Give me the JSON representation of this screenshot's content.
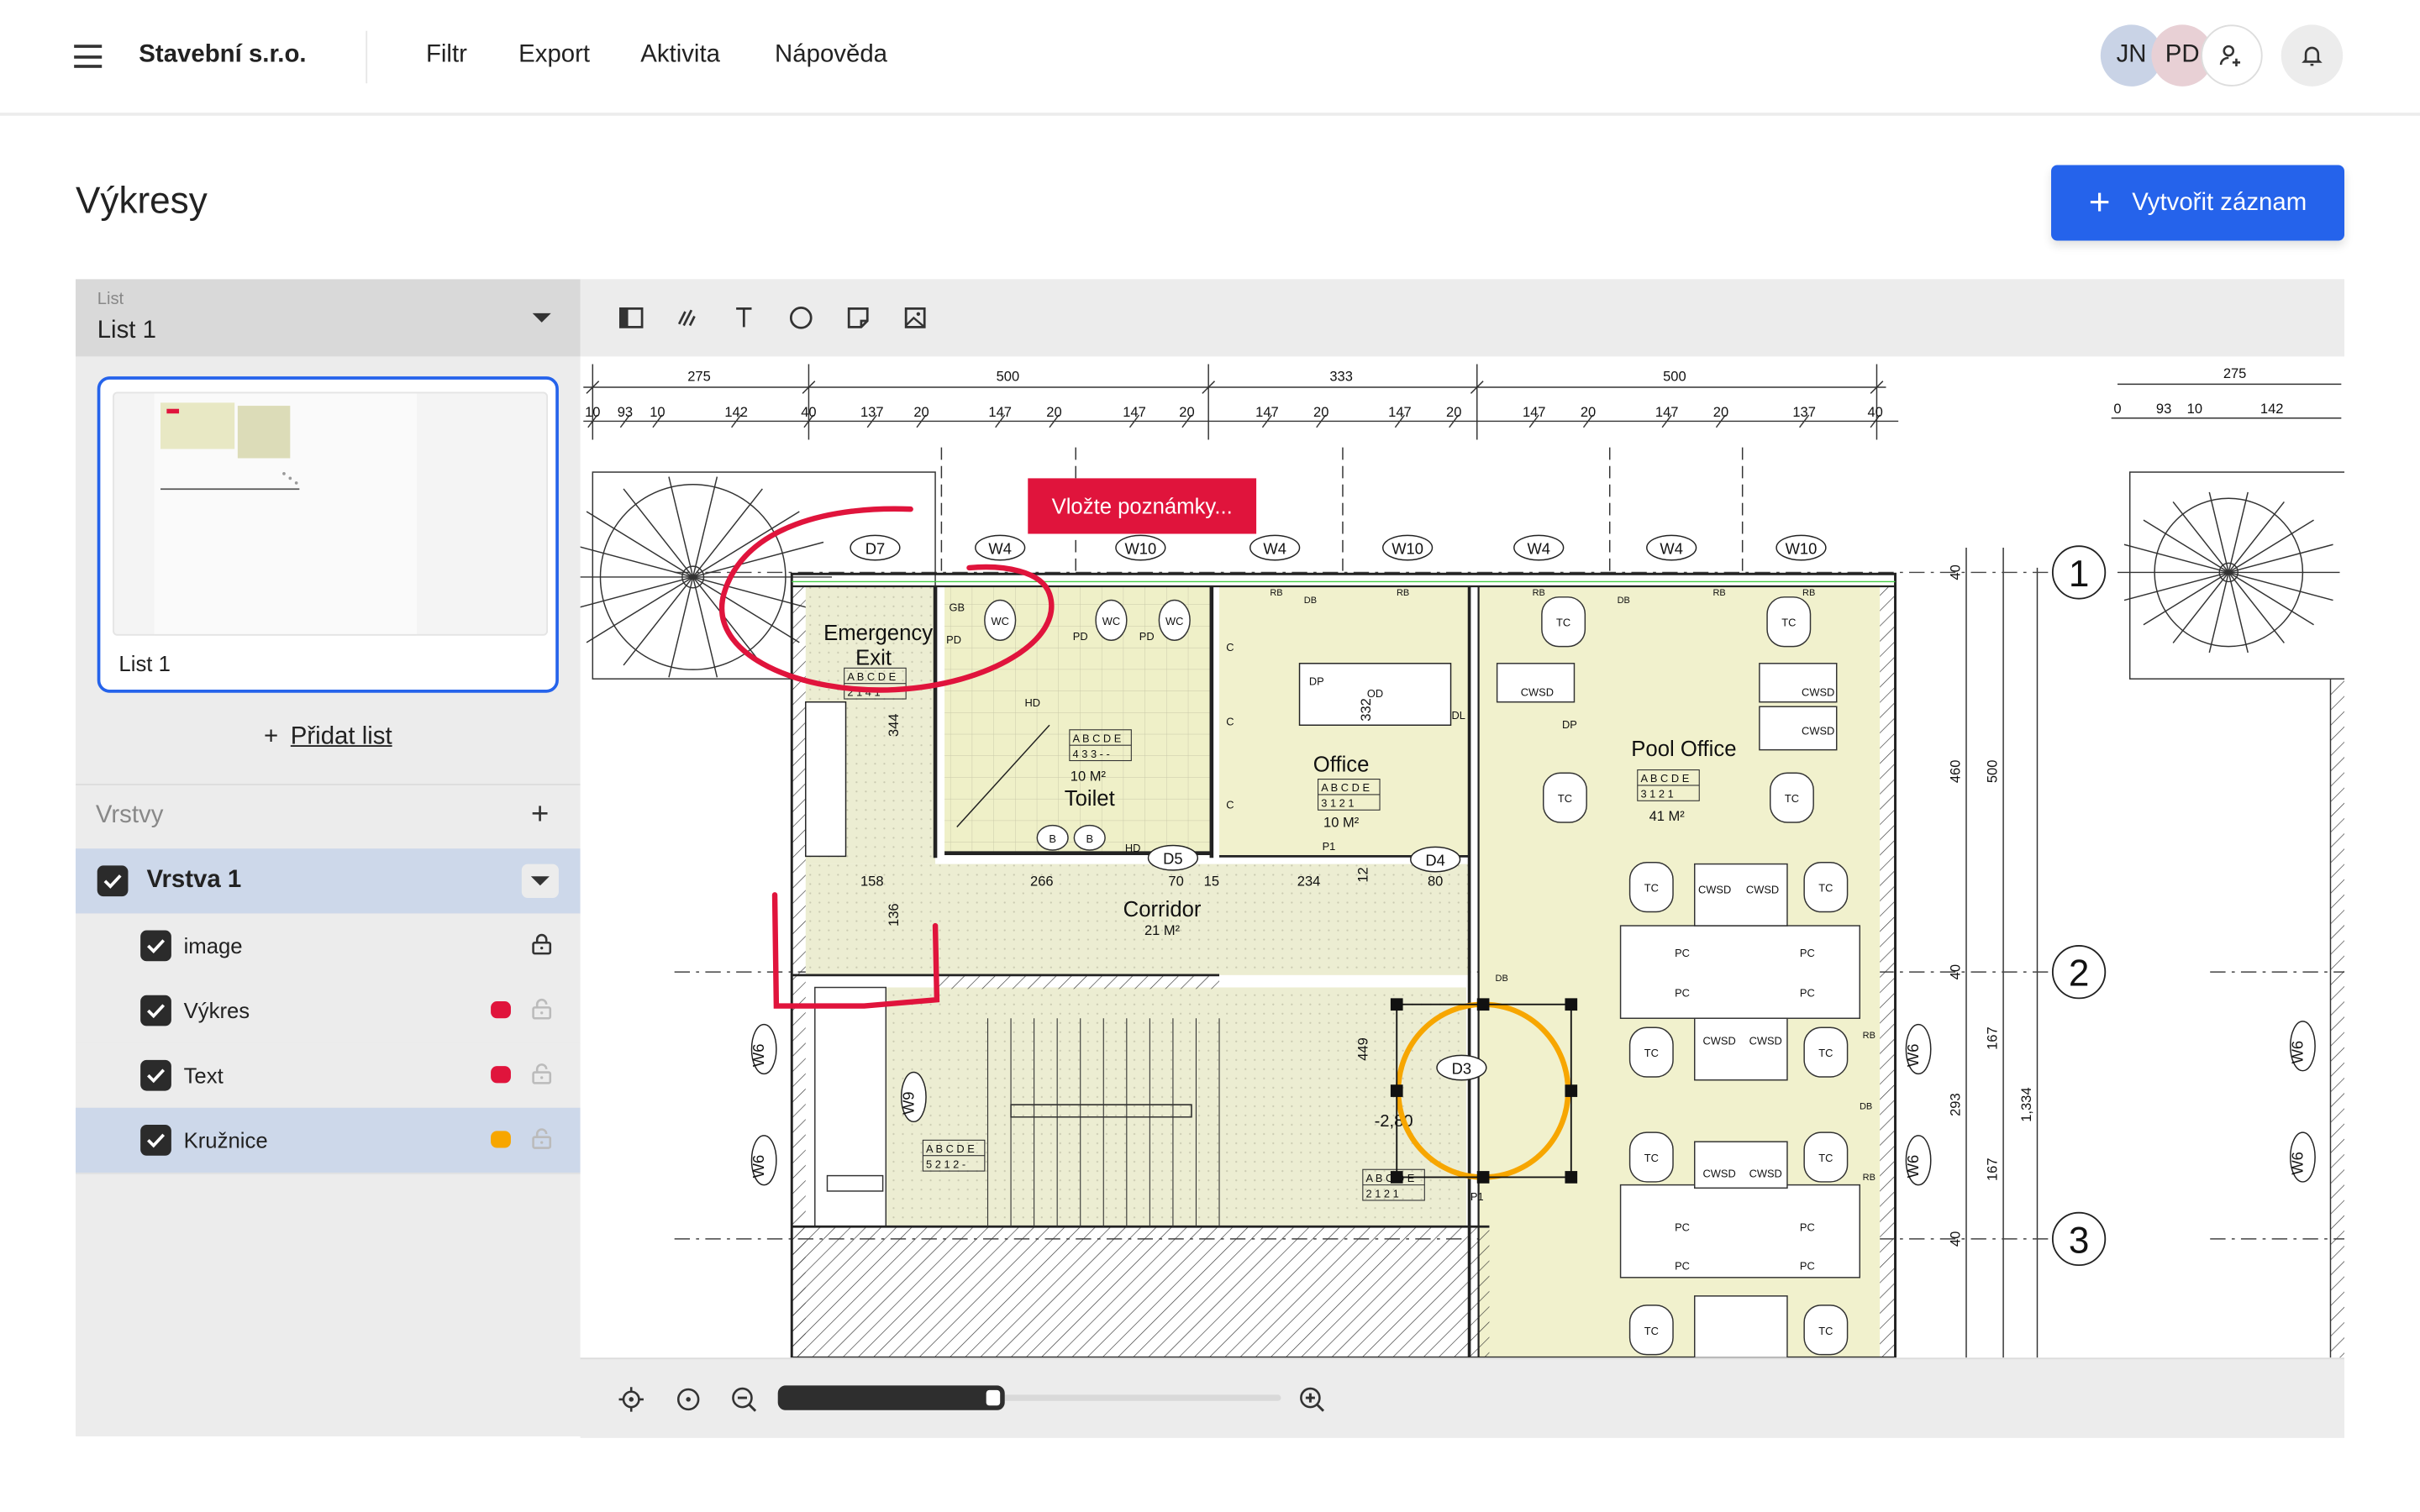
{
  "header": {
    "company": "Stavební s.r.o.",
    "nav": [
      "Filtr",
      "Export",
      "Aktivita",
      "Nápověda"
    ],
    "avatars": [
      {
        "initials": "JN",
        "color": "#c9d3e6"
      },
      {
        "initials": "PD",
        "color": "#e8d0d5"
      }
    ],
    "icons": {
      "menu": "hamburger-icon",
      "add_user": "user-plus-icon",
      "notifications": "bell-icon"
    }
  },
  "page": {
    "title": "Výkresy",
    "create_button": "Vytvořit záznam",
    "accent": "#2563eb"
  },
  "sheets": {
    "select_label": "List",
    "selected": "List 1",
    "items": [
      {
        "label": "List 1",
        "selected": true
      }
    ],
    "add_label": "Přidat list"
  },
  "layers": {
    "title": "Vrstvy",
    "group": {
      "name": "Vrstva 1",
      "checked": true,
      "expanded": true
    },
    "items": [
      {
        "name": "image",
        "checked": true,
        "locked": true,
        "color": null
      },
      {
        "name": "Výkres",
        "checked": true,
        "locked": false,
        "color": "#e0143c"
      },
      {
        "name": "Text",
        "checked": true,
        "locked": false,
        "color": "#e0143c"
      },
      {
        "name": "Kružnice",
        "checked": true,
        "locked": false,
        "color": "#f7a600",
        "selected": true
      }
    ]
  },
  "toolbar": {
    "tools": [
      "sidebar-toggle-icon",
      "freehand-icon",
      "text-icon",
      "circle-icon",
      "note-icon",
      "image-icon"
    ]
  },
  "zoom": {
    "level": 0.42,
    "icons": [
      "locate-icon",
      "center-icon",
      "zoom-out-icon",
      "zoom-in-icon"
    ]
  },
  "plan": {
    "note": "Vložte poznámky...",
    "annotation_colors": {
      "pen": "#e0143c",
      "circle": "#f7a600"
    },
    "rooms": {
      "emergency": [
        "Emergency",
        "Exit"
      ],
      "toilet": "Toilet",
      "toilet_area": "10 M²",
      "office": "Office",
      "office_area": "10 M²",
      "pool": "Pool Office",
      "pool_area": "41 M²",
      "corridor": "Corridor",
      "corridor_area": "21 M²"
    },
    "dims_top": [
      "275",
      "500",
      "333",
      "500",
      "275"
    ],
    "dims_detail": [
      "10",
      "93",
      "10",
      "142",
      "40",
      "137",
      "20",
      "147",
      "20",
      "147",
      "20",
      "147",
      "20",
      "147",
      "20",
      "147",
      "20",
      "147",
      "20",
      "137",
      "40"
    ],
    "dims_detail_right": [
      "0",
      "93",
      "10",
      "142"
    ],
    "dims_vertical": [
      "40",
      "460",
      "500",
      "40",
      "167",
      "293",
      "1,334",
      "167",
      "40"
    ],
    "dims_inner": [
      "344",
      "332",
      "449",
      "136",
      "12",
      "158",
      "266",
      "70",
      "15",
      "234",
      "80"
    ],
    "tags": [
      "D7",
      "W4",
      "W10",
      "W4",
      "W10",
      "W4",
      "W4",
      "W10",
      "D5",
      "D4",
      "D3",
      "W6",
      "W6",
      "W9",
      "W6",
      "W6",
      "W6",
      "W6"
    ],
    "grid_axes": [
      "1",
      "2",
      "3"
    ],
    "fixtures": {
      "wc": "WC",
      "tc": "TC",
      "cwsd": "CWSD",
      "pc": "PC",
      "c": "C",
      "dp": "DP",
      "rb": "RB",
      "db": "DB",
      "hd": "HD",
      "b": "B",
      "od": "OD",
      "dl": "DL",
      "p1": "P1",
      "gb": "GB",
      "pd": "PD"
    },
    "code_header": "A B C D E",
    "codes": [
      "2 1 4 1",
      "4 3 3 - -",
      "3 1 2 1",
      "3 1 2 1",
      "5 2 1 2 -",
      "2 1 2 1"
    ],
    "level": "-2,80"
  }
}
